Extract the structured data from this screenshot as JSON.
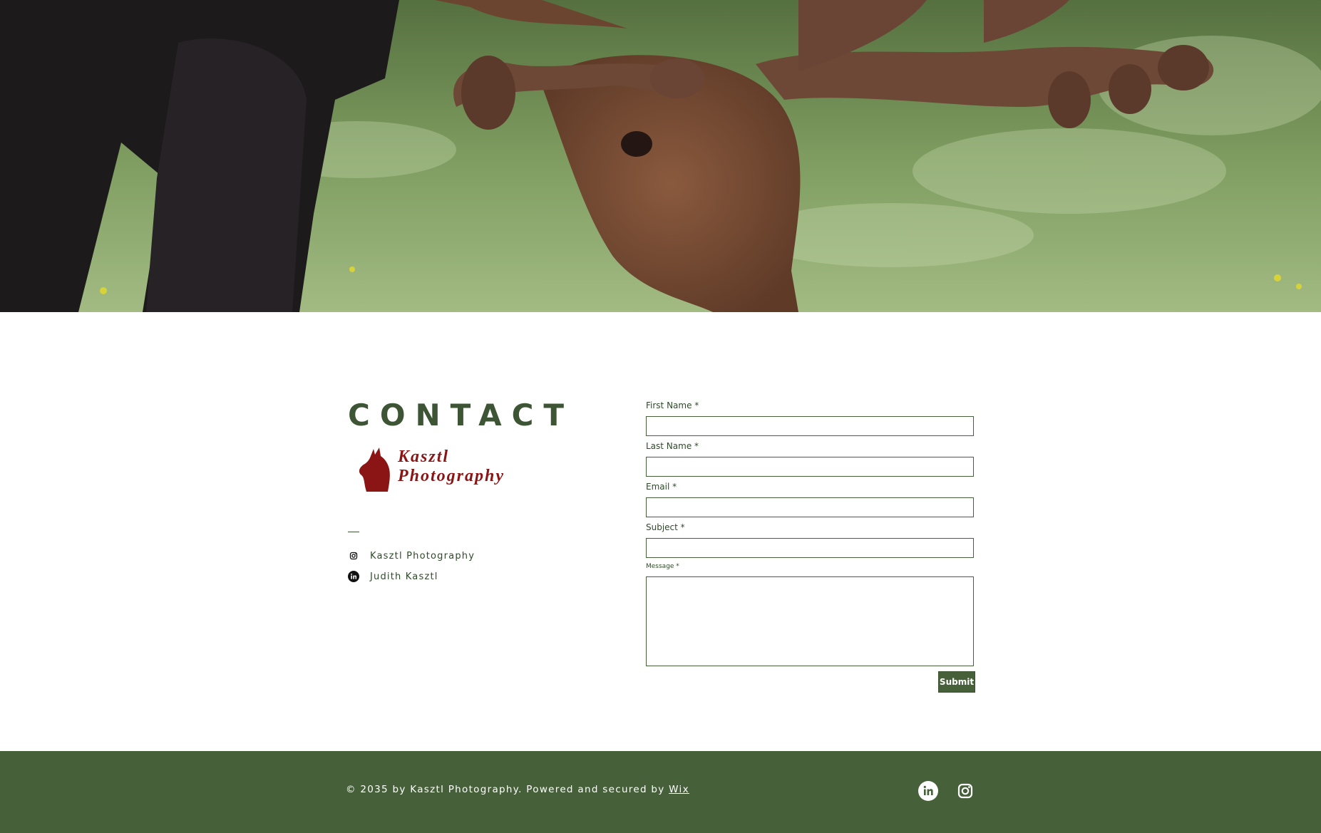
{
  "hero": {
    "image": "moose-grazing-photo"
  },
  "contact": {
    "heading": "CONTACT",
    "logo": {
      "line1": "Kasztl",
      "line2": "Photography",
      "icon": "howling-wolf-icon",
      "color": "#8b1414"
    },
    "social": [
      {
        "label": "Kasztl Photography",
        "icon": "instagram-icon"
      },
      {
        "label": "Judith Kasztl",
        "icon": "linkedin-icon"
      }
    ]
  },
  "form": {
    "first_name_label": "First Name *",
    "first_name_value": "",
    "last_name_label": "Last Name *",
    "last_name_value": "",
    "email_label": "Email *",
    "email_value": "",
    "subject_label": "Subject *",
    "subject_value": "",
    "message_label": "Message *",
    "message_value": "",
    "submit_label": "Submit"
  },
  "footer": {
    "copyright": "© 2035 by Kasztl Photography. Powered and secured by ",
    "link": "Wix",
    "icons": [
      "linkedin-icon",
      "instagram-icon"
    ]
  },
  "colors": {
    "accent": "#46603a",
    "heading": "#3d5535",
    "text": "#2f4a2a",
    "brand": "#8b1414",
    "background": "#ffffff"
  }
}
